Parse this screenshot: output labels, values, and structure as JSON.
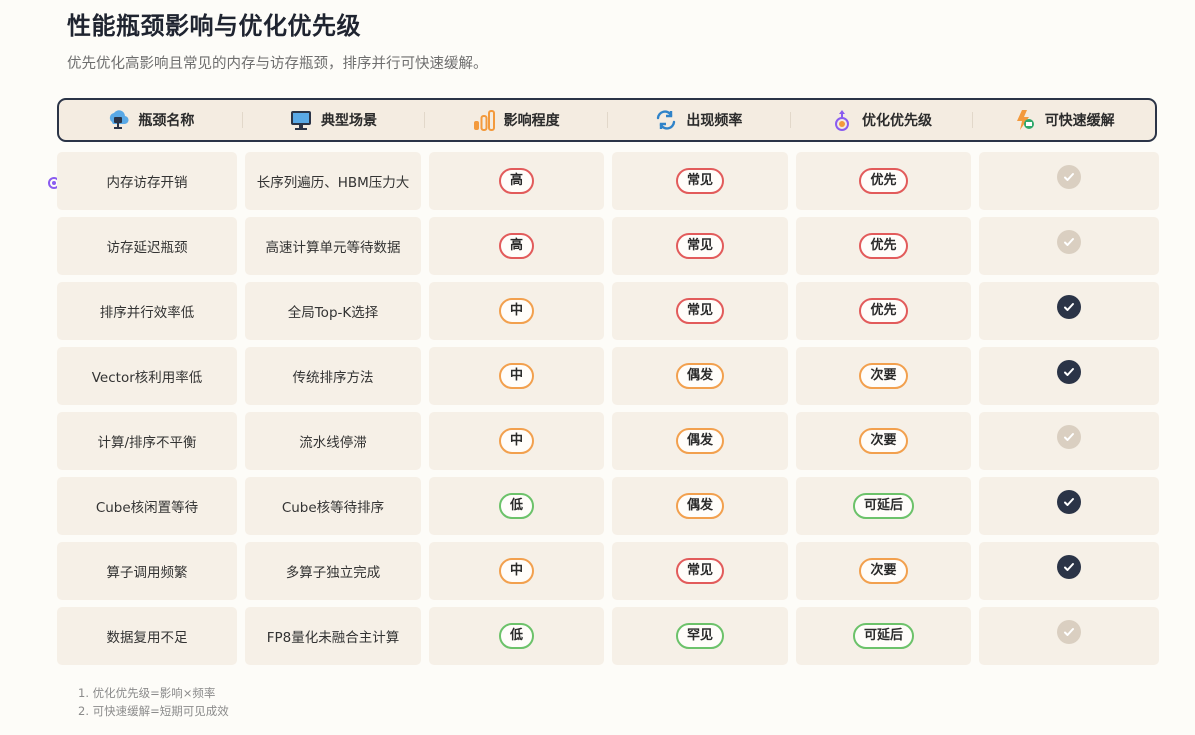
{
  "title": "性能瓶颈影响与优化优先级",
  "subtitle": "优先优化高影响且常见的内存与访存瓶颈，排序并行可快速缓解。",
  "headers": [
    {
      "label": "瓶颈名称",
      "icon": "cloud-monitor-icon"
    },
    {
      "label": "典型场景",
      "icon": "monitor-icon"
    },
    {
      "label": "影响程度",
      "icon": "bar-chart-icon"
    },
    {
      "label": "出现频率",
      "icon": "refresh-icon"
    },
    {
      "label": "优化优先级",
      "icon": "priority-flask-icon"
    },
    {
      "label": "可快速缓解",
      "icon": "quick-fix-icon"
    }
  ],
  "rows": [
    {
      "name": "内存访存开销",
      "scenario": "长序列遍历、HBM压力大",
      "impact": "高",
      "frequency": "常见",
      "priority": "优先",
      "quick": false
    },
    {
      "name": "访存延迟瓶颈",
      "scenario": "高速计算单元等待数据",
      "impact": "高",
      "frequency": "常见",
      "priority": "优先",
      "quick": false
    },
    {
      "name": "排序并行效率低",
      "scenario": "全局Top-K选择",
      "impact": "中",
      "frequency": "常见",
      "priority": "优先",
      "quick": true
    },
    {
      "name": "Vector核利用率低",
      "scenario": "传统排序方法",
      "impact": "中",
      "frequency": "偶发",
      "priority": "次要",
      "quick": true
    },
    {
      "name": "计算/排序不平衡",
      "scenario": "流水线停滞",
      "impact": "中",
      "frequency": "偶发",
      "priority": "次要",
      "quick": false
    },
    {
      "name": "Cube核闲置等待",
      "scenario": "Cube核等待排序",
      "impact": "低",
      "frequency": "偶发",
      "priority": "可延后",
      "quick": true
    },
    {
      "name": "算子调用频繁",
      "scenario": "多算子独立完成",
      "impact": "中",
      "frequency": "常见",
      "priority": "次要",
      "quick": true
    },
    {
      "name": "数据复用不足",
      "scenario": "FP8量化未融合主计算",
      "impact": "低",
      "frequency": "罕见",
      "priority": "可延后",
      "quick": false
    }
  ],
  "pill_colors": {
    "高": "#e25b5b",
    "中": "#f2a04e",
    "低": "#6cc26a",
    "常见": "#e25b5b",
    "偶发": "#f2a04e",
    "罕见": "#6cc26a",
    "优先": "#e25b5b",
    "次要": "#f2a04e",
    "可延后": "#6cc26a"
  },
  "notes": [
    "1. 优化优先级=影响×频率",
    "2. 可快速缓解=短期可见成效"
  ]
}
